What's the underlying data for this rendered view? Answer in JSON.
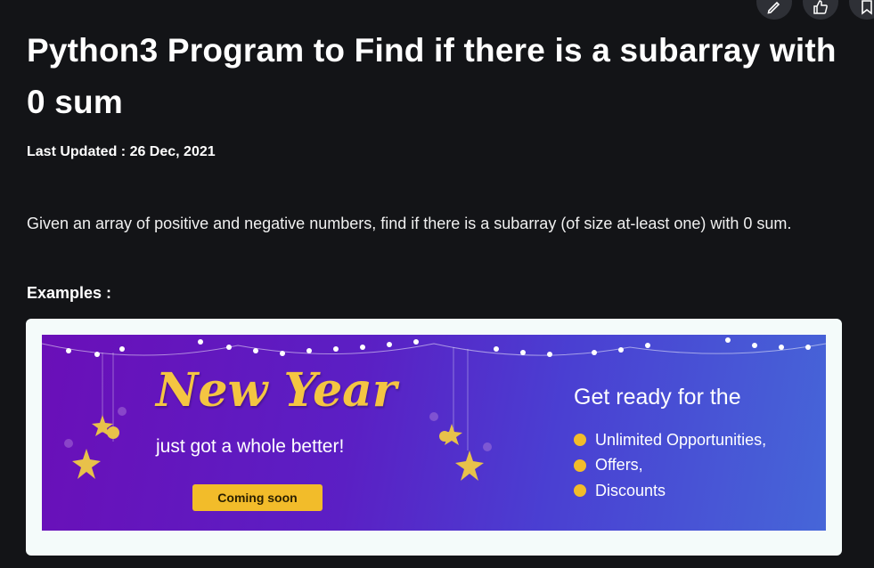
{
  "article": {
    "title": "Python3 Program to Find if there is a subarray with 0 sum",
    "last_updated": "Last Updated : 26 Dec, 2021",
    "intro": "Given an array of positive and negative numbers, find if there is a subarray (of size at-least one) with 0 sum.",
    "examples_heading": "Examples :"
  },
  "actions": [
    {
      "name": "edit-icon"
    },
    {
      "name": "thumbs-up-icon"
    },
    {
      "name": "bookmark-icon"
    }
  ],
  "banner": {
    "headline": "New Year",
    "subline": "just got a whole better!",
    "cta_label": "Coming soon",
    "ready_text": "Get ready for the",
    "bullets": [
      "Unlimited Opportunities,",
      "Offers,",
      "Discounts"
    ]
  },
  "colors": {
    "page_background": "#131417",
    "banner_gold": "#f4c542",
    "banner_purple": "#6a0fb8",
    "banner_blue": "#4666d8"
  }
}
